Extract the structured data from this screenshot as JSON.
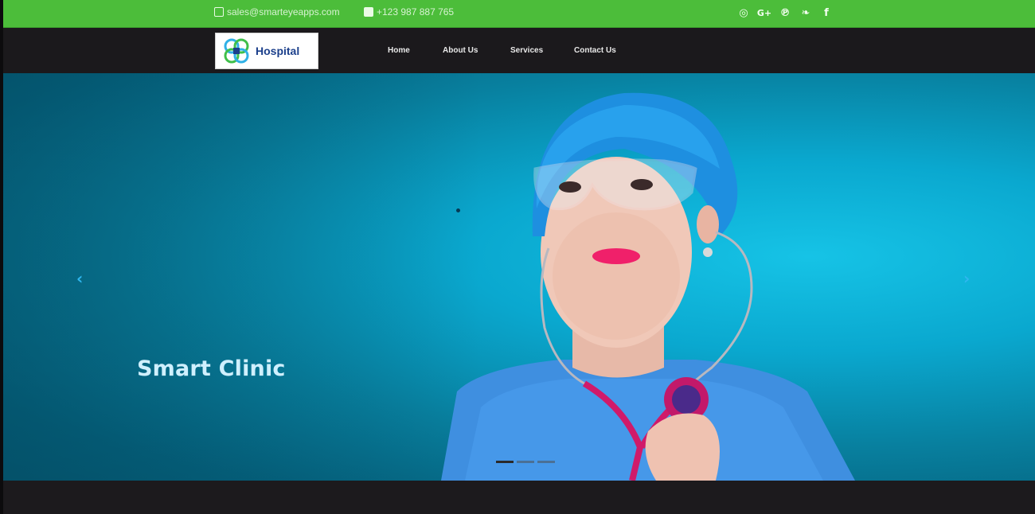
{
  "topbar": {
    "email": "sales@smarteyeapps.com",
    "phone": "+123 987 887 765",
    "socials": [
      {
        "name": "github-icon",
        "glyph": "◎"
      },
      {
        "name": "google-plus-icon",
        "glyph": "G+"
      },
      {
        "name": "pinterest-icon",
        "glyph": "℗"
      },
      {
        "name": "twitter-icon",
        "glyph": "❧"
      },
      {
        "name": "facebook-icon",
        "glyph": "f"
      }
    ],
    "color": "#4cbd3a"
  },
  "navbar": {
    "logo_text": "Hospital",
    "links": [
      "Home",
      "About Us",
      "Services",
      "Contact Us"
    ]
  },
  "hero": {
    "title": "Smart Clinic",
    "prev_glyph": "‹",
    "next_glyph": "›",
    "slides": 3,
    "active_slide": 1
  }
}
